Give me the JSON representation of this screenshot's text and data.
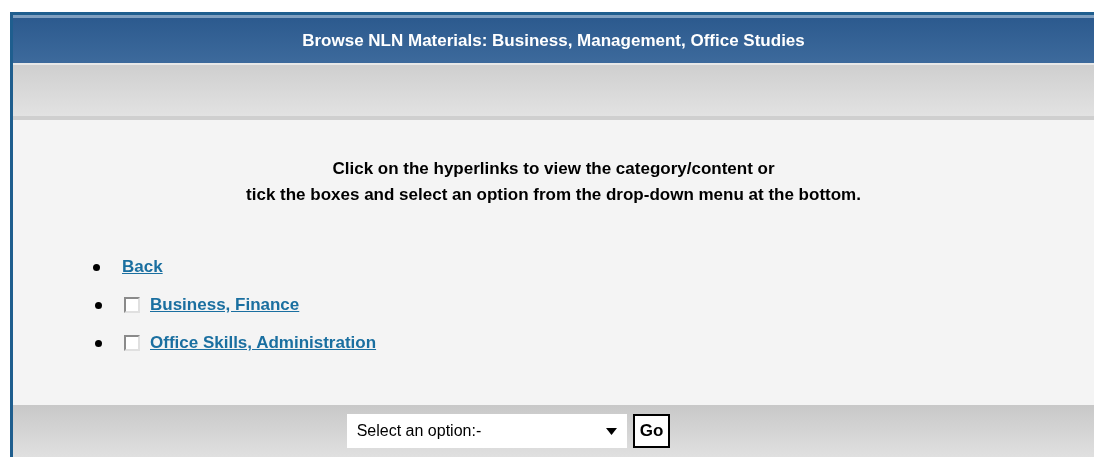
{
  "header": {
    "title": "Browse NLN Materials: Business, Management, Office Studies"
  },
  "instructions": [
    "Click on the hyperlinks to view the category/content or",
    "tick the boxes and select an option from the drop-down menu at the bottom."
  ],
  "items": [
    {
      "kind": "link",
      "label": "Back"
    },
    {
      "kind": "checkbox",
      "label": "Business, Finance",
      "checked": false
    },
    {
      "kind": "checkbox",
      "label": "Office Skills, Administration",
      "checked": false
    }
  ],
  "footer": {
    "select": {
      "value": "Select an option:-"
    },
    "button": "Go"
  }
}
